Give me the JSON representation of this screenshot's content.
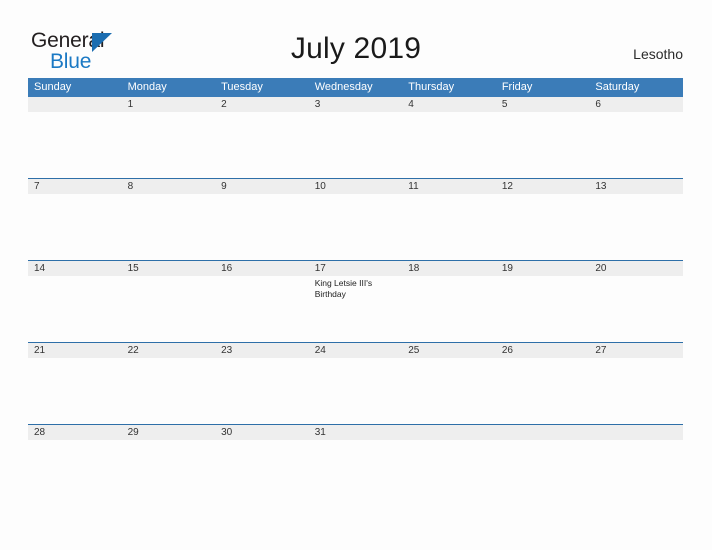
{
  "brand": {
    "name_dark": "General",
    "name_blue": "Blue",
    "accent_color": "#1b79c4",
    "logo_triangle_color": "#1b6db0"
  },
  "header": {
    "title": "July 2019",
    "country": "Lesotho"
  },
  "colors": {
    "header_row_bg": "#3b7cb8",
    "date_band_bg": "#eeeeee",
    "week_divider": "#2e6fa8",
    "page_bg": "#fdfdfd",
    "text": "#333333"
  },
  "calendar": {
    "month": "July",
    "year": "2019",
    "weekdays": [
      "Sunday",
      "Monday",
      "Tuesday",
      "Wednesday",
      "Thursday",
      "Friday",
      "Saturday"
    ],
    "weeks": [
      {
        "days": [
          {
            "num": "",
            "events": []
          },
          {
            "num": "1",
            "events": []
          },
          {
            "num": "2",
            "events": []
          },
          {
            "num": "3",
            "events": []
          },
          {
            "num": "4",
            "events": []
          },
          {
            "num": "5",
            "events": []
          },
          {
            "num": "6",
            "events": []
          }
        ]
      },
      {
        "days": [
          {
            "num": "7",
            "events": []
          },
          {
            "num": "8",
            "events": []
          },
          {
            "num": "9",
            "events": []
          },
          {
            "num": "10",
            "events": []
          },
          {
            "num": "11",
            "events": []
          },
          {
            "num": "12",
            "events": []
          },
          {
            "num": "13",
            "events": []
          }
        ]
      },
      {
        "days": [
          {
            "num": "14",
            "events": []
          },
          {
            "num": "15",
            "events": []
          },
          {
            "num": "16",
            "events": []
          },
          {
            "num": "17",
            "events": [
              "King Letsie III's Birthday"
            ]
          },
          {
            "num": "18",
            "events": []
          },
          {
            "num": "19",
            "events": []
          },
          {
            "num": "20",
            "events": []
          }
        ]
      },
      {
        "days": [
          {
            "num": "21",
            "events": []
          },
          {
            "num": "22",
            "events": []
          },
          {
            "num": "23",
            "events": []
          },
          {
            "num": "24",
            "events": []
          },
          {
            "num": "25",
            "events": []
          },
          {
            "num": "26",
            "events": []
          },
          {
            "num": "27",
            "events": []
          }
        ]
      },
      {
        "days": [
          {
            "num": "28",
            "events": []
          },
          {
            "num": "29",
            "events": []
          },
          {
            "num": "30",
            "events": []
          },
          {
            "num": "31",
            "events": []
          },
          {
            "num": "",
            "events": []
          },
          {
            "num": "",
            "events": []
          },
          {
            "num": "",
            "events": []
          }
        ]
      }
    ]
  }
}
